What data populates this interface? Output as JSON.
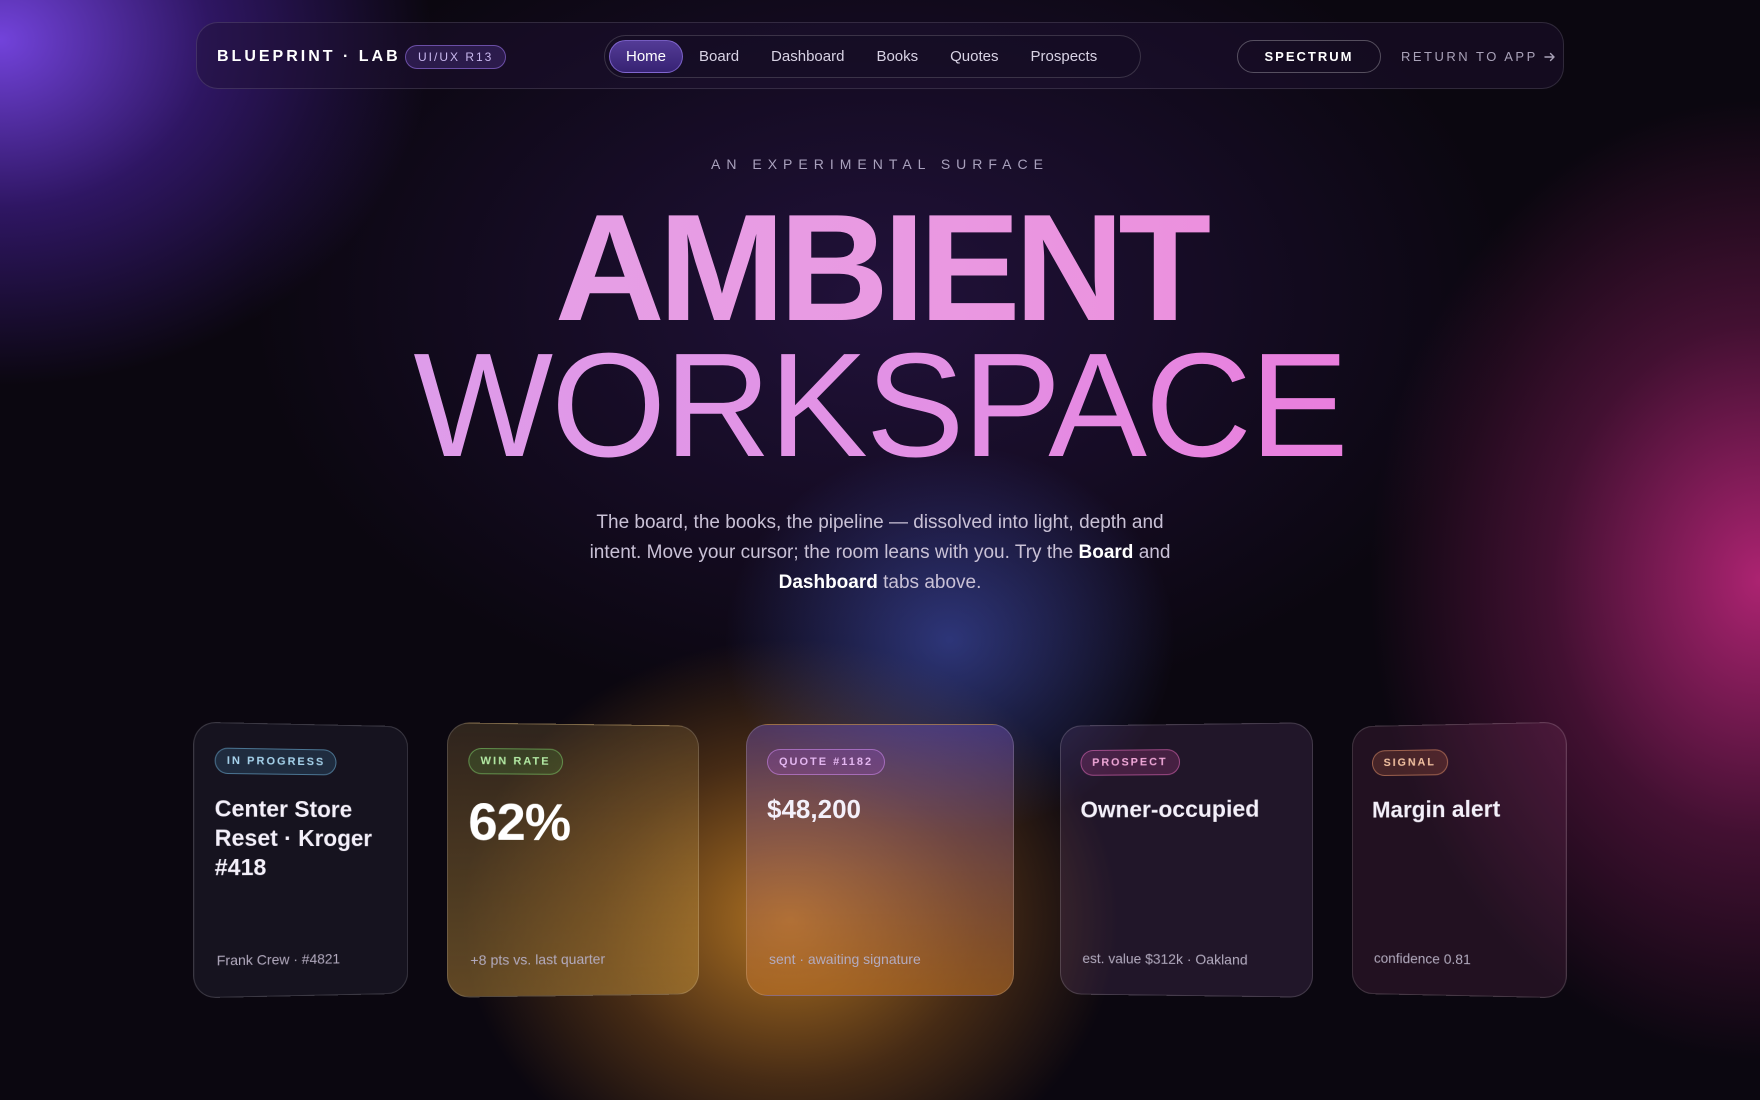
{
  "header": {
    "brand": "BLUEPRINT · LAB",
    "version": "UI/UX R13",
    "tabs": [
      {
        "label": "Home",
        "active": true
      },
      {
        "label": "Board",
        "active": false
      },
      {
        "label": "Dashboard",
        "active": false
      },
      {
        "label": "Books",
        "active": false
      },
      {
        "label": "Quotes",
        "active": false
      },
      {
        "label": "Prospects",
        "active": false
      }
    ],
    "spectrum_label": "SPECTRUM",
    "return_label": "RETURN TO APP",
    "return_icon": "arrow-right-icon"
  },
  "hero": {
    "eyebrow": "AN EXPERIMENTAL SURFACE",
    "title_line1": "AMBIENT",
    "title_line2": "WORKSPACE",
    "lede_part1": "The board, the books, the pipeline — dissolved into light, depth and intent. Move your cursor; the room leans with you. Try the ",
    "lede_bold1": "Board",
    "lede_part2": " and ",
    "lede_bold2": "Dashboard",
    "lede_part3": " tabs above."
  },
  "cards": [
    {
      "badge": "IN PROGRESS",
      "headline": "Center Store Reset · Kroger #418",
      "footer": "Frank Crew · #4821"
    },
    {
      "badge": "WIN RATE",
      "headline": "62%",
      "footer": "+8 pts vs. last quarter"
    },
    {
      "badge": "QUOTE #1182",
      "headline": "$48,200",
      "footer": "sent · awaiting signature"
    },
    {
      "badge": "PROSPECT",
      "headline": "Owner-occupied",
      "footer": "est. value $312k · Oakland"
    },
    {
      "badge": "SIGNAL",
      "headline": "Margin alert",
      "footer": "confidence 0.81"
    }
  ],
  "colors": {
    "accent_violet": "#7a48e0",
    "accent_magenta": "#e23fa0",
    "accent_amber": "#e69628"
  }
}
